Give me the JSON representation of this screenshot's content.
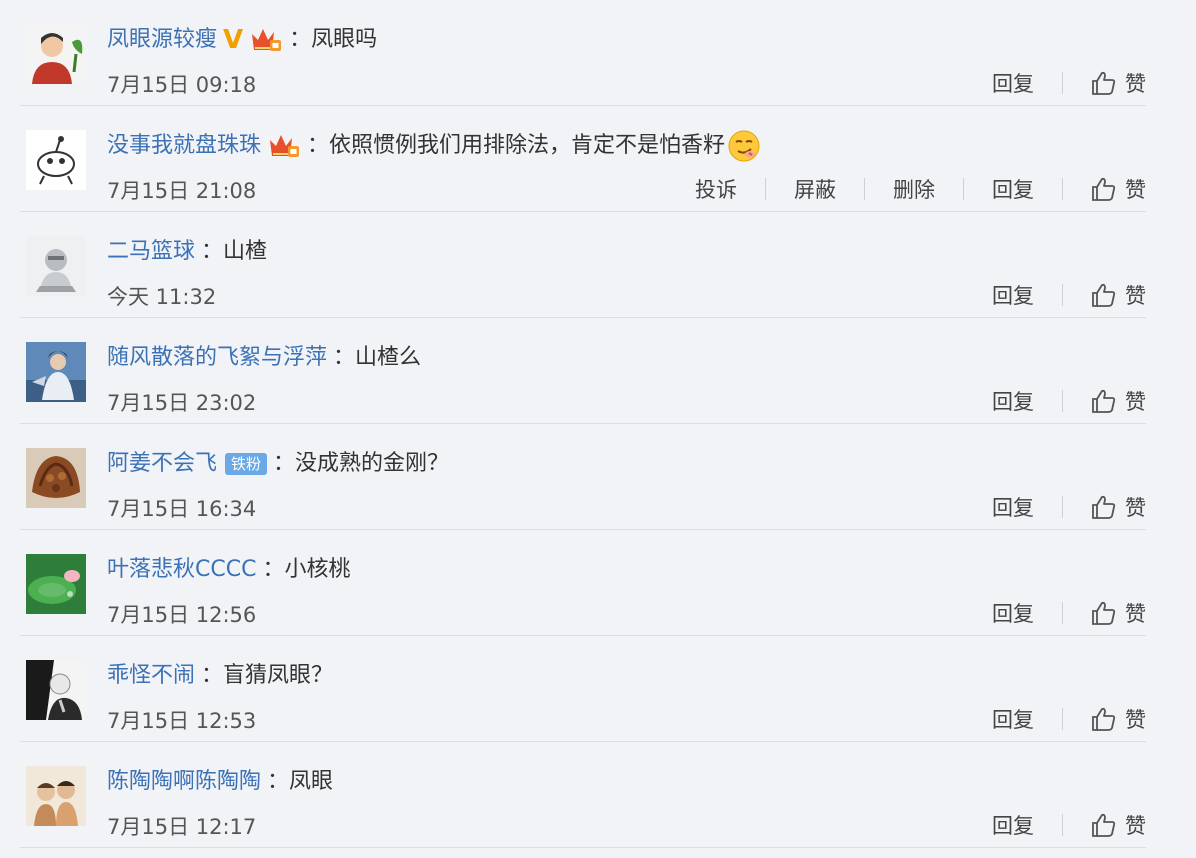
{
  "actions": {
    "reply": "回复",
    "like": "赞",
    "report": "投诉",
    "block": "屏蔽",
    "delete": "删除"
  },
  "comments": [
    {
      "username": "凤眼源较瘦",
      "badges": [
        "verified-v",
        "vip-crown"
      ],
      "text": "凤眼吗",
      "emoji": null,
      "timestamp": "7月15日 09:18",
      "avatar": "man-with-plant-avatar",
      "extra_actions": false
    },
    {
      "username": "没事我就盘珠珠",
      "badges": [
        "vip-crown"
      ],
      "text": "依照惯例我们用排除法，肯定不是怕香籽",
      "emoji": "smirk-emoji",
      "timestamp": "7月15日 21:08",
      "avatar": "cartoon-bird-avatar",
      "extra_actions": true
    },
    {
      "username": "二马篮球",
      "badges": [],
      "text": "山楂",
      "emoji": null,
      "timestamp": "今天 11:32",
      "avatar": "statue-avatar",
      "extra_actions": false
    },
    {
      "username": "随风散落的飞絮与浮萍",
      "badges": [],
      "text": "山楂么",
      "emoji": null,
      "timestamp": "7月15日 23:02",
      "avatar": "anime-character-avatar",
      "extra_actions": false
    },
    {
      "username": "阿姜不会飞",
      "badges": [
        "iron-fan"
      ],
      "iron_fan_label": "铁粉",
      "text": "没成熟的金刚？",
      "emoji": null,
      "timestamp": "7月15日 16:34",
      "avatar": "dried-fruit-avatar",
      "extra_actions": false
    },
    {
      "username": "叶落悲秋CCCC",
      "badges": [],
      "text": "小核桃",
      "emoji": null,
      "timestamp": "7月15日 12:56",
      "avatar": "lotus-leaf-avatar",
      "extra_actions": false
    },
    {
      "username": "乖怪不闹",
      "badges": [],
      "text": "盲猜凤眼？",
      "emoji": null,
      "timestamp": "7月15日 12:53",
      "avatar": "black-white-portrait-avatar",
      "extra_actions": false
    },
    {
      "username": "陈陶陶啊陈陶陶",
      "badges": [],
      "text": "凤眼",
      "emoji": null,
      "timestamp": "7月15日 12:17",
      "avatar": "couple-photo-avatar",
      "extra_actions": false
    }
  ],
  "colors": {
    "username": "#3b72b6",
    "background": "#f2f3f7",
    "verified": "#f2a000",
    "iron_fan": "#6aa9e6"
  }
}
